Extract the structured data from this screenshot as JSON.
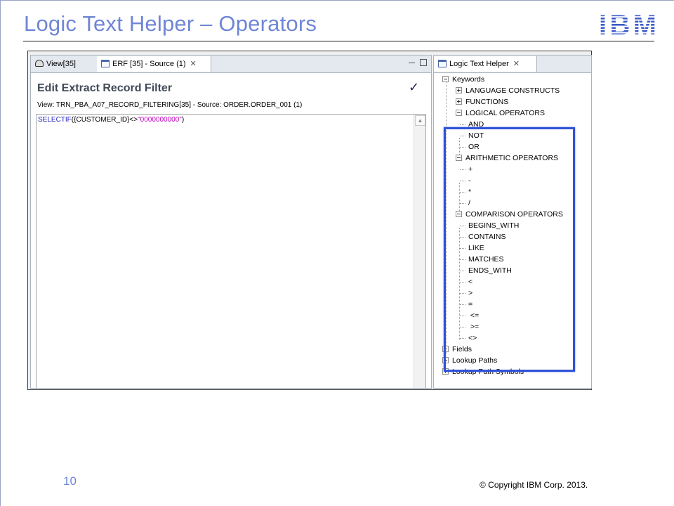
{
  "slide": {
    "title": "Logic Text Helper – Operators",
    "logo": "IBM",
    "page_number": "10",
    "copyright": "© Copyright  IBM Corp. 2013."
  },
  "editor": {
    "tabs": [
      {
        "label": "View[35]",
        "icon": "eye-icon"
      },
      {
        "label": "ERF [35] - Source (1)",
        "icon": "document-icon"
      }
    ],
    "heading": "Edit Extract Record Filter",
    "view_line": "View: TRN_PBA_A07_RECORD_FILTERING[35] - Source: ORDER.ORDER_001 (1)",
    "code": {
      "keyword": "SELECTIF",
      "middle": "({CUSTOMER_ID}<>",
      "string": "\"0000000000\"",
      "end": ")"
    }
  },
  "helper": {
    "tab_label": "Logic Text Helper",
    "tree": {
      "keywords": "Keywords",
      "language_constructs": "LANGUAGE CONSTRUCTS",
      "functions": "FUNCTIONS",
      "logical": {
        "label": "LOGICAL OPERATORS",
        "items": [
          "AND",
          "NOT",
          "OR"
        ]
      },
      "arithmetic": {
        "label": "ARITHMETIC OPERATORS",
        "items": [
          "+",
          "-",
          "*",
          "/"
        ]
      },
      "comparison": {
        "label": "COMPARISON OPERATORS",
        "items": [
          "BEGINS_WITH",
          "CONTAINS",
          "LIKE",
          "MATCHES",
          "ENDS_WITH",
          "<",
          ">",
          "=",
          " <=",
          " >=",
          "<>"
        ]
      },
      "fields": "Fields",
      "lookup_paths": "Lookup Paths",
      "lookup_path_symbols": "Lookup Path Symbols"
    }
  },
  "colors": {
    "title": "#6f86d6",
    "highlight": "#2f52d8",
    "logo": "#3b5bc9"
  }
}
